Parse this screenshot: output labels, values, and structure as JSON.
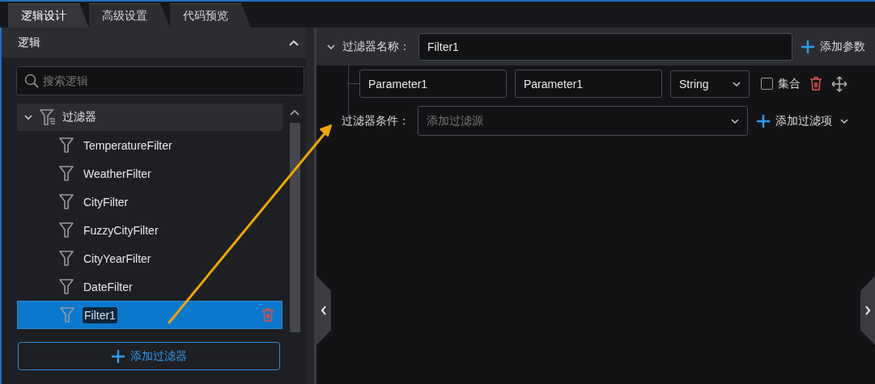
{
  "tabs": [
    {
      "label": "逻辑设计",
      "selected": true
    },
    {
      "label": "高级设置",
      "selected": false
    },
    {
      "label": "代码预览",
      "selected": false
    }
  ],
  "sidebar": {
    "title": "逻辑",
    "search": {
      "placeholder": "搜索逻辑"
    },
    "tree": {
      "label": "过滤器",
      "expanded": true,
      "children": [
        {
          "label": "TemperatureFilter",
          "selected": false,
          "editing": false
        },
        {
          "label": "WeatherFilter",
          "selected": false,
          "editing": false
        },
        {
          "label": "CityFilter",
          "selected": false,
          "editing": false
        },
        {
          "label": "FuzzyCityFilter",
          "selected": false,
          "editing": false
        },
        {
          "label": "CityYearFilter",
          "selected": false,
          "editing": false
        },
        {
          "label": "DateFilter",
          "selected": false,
          "editing": false
        },
        {
          "label": "Filter1",
          "selected": true,
          "editing": true
        }
      ]
    },
    "add_button": "添加过滤器"
  },
  "editor": {
    "expanded": true,
    "name_label": "过滤器名称：",
    "name_value": "Filter1",
    "add_parameter": "添加参数",
    "parameters": [
      {
        "name": "Parameter1",
        "display_name": "Parameter1",
        "type": "String",
        "collection_label": "集合",
        "collection": false
      }
    ],
    "condition_label": "过滤器条件：",
    "condition_placeholder": "添加过滤源",
    "add_filter_item": "添加过滤项"
  }
}
